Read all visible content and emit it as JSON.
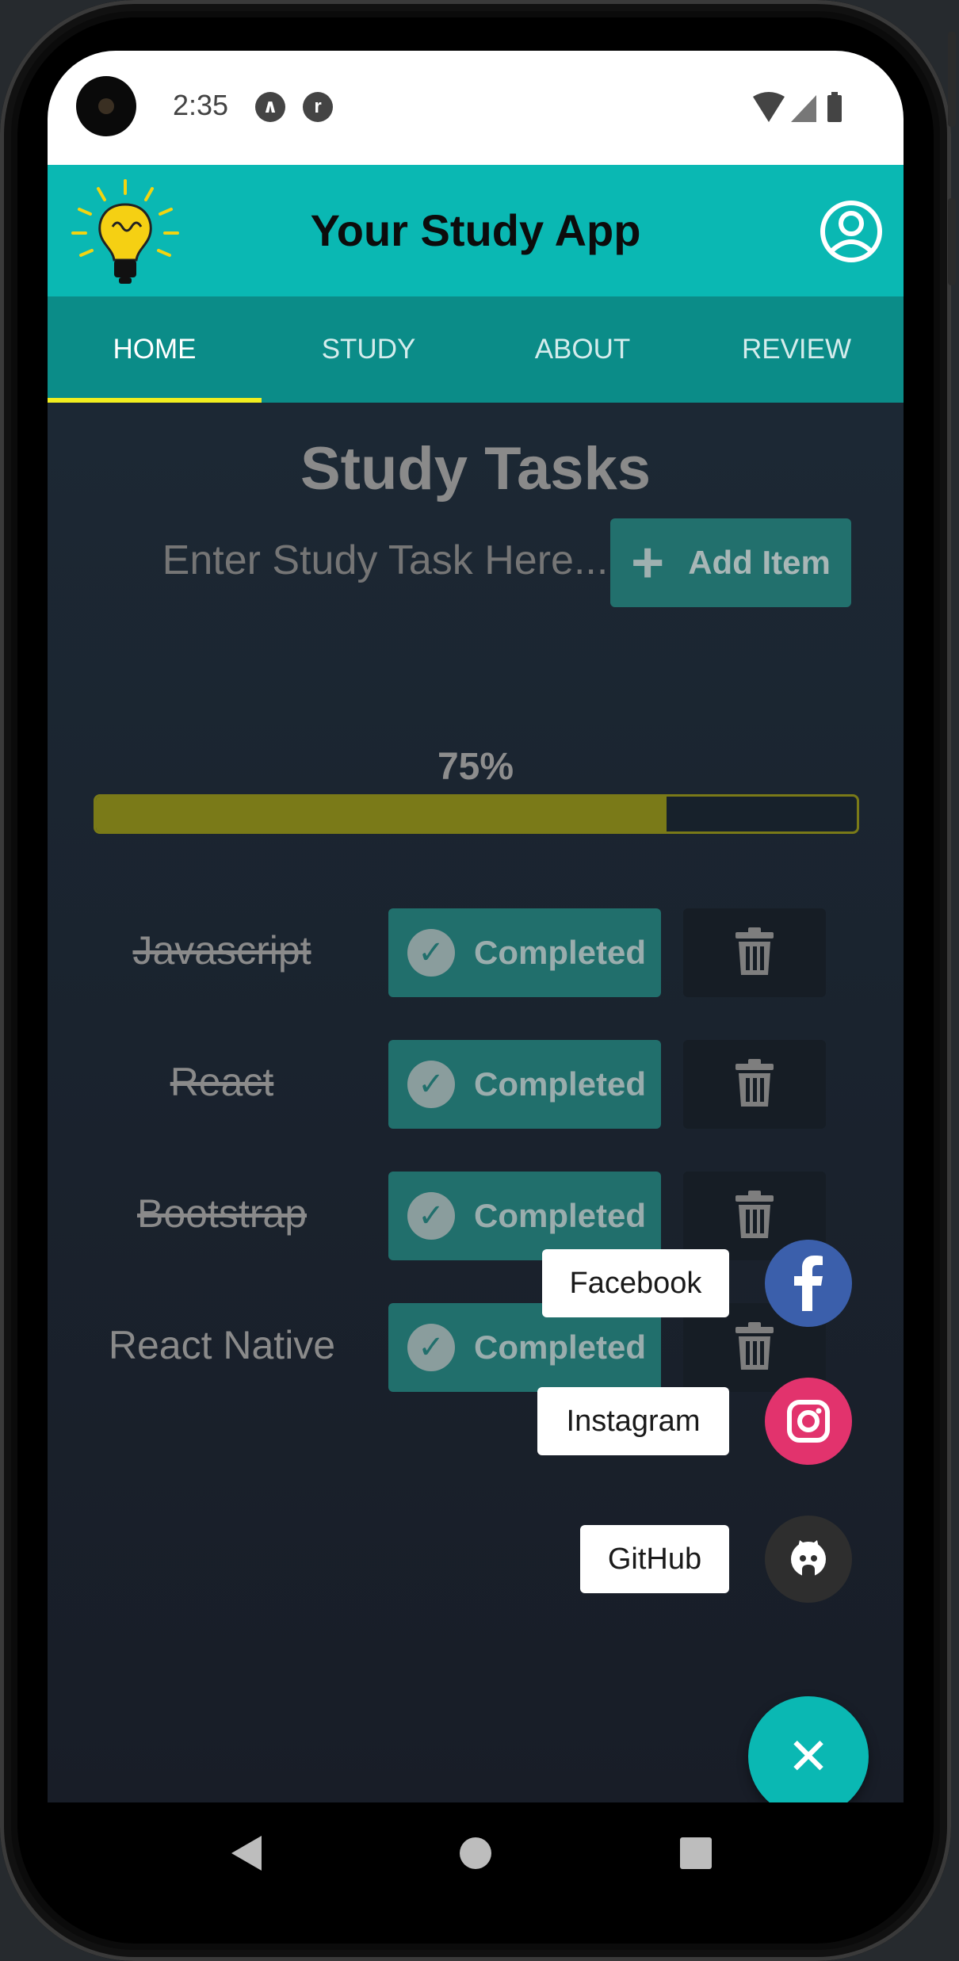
{
  "status": {
    "time": "2:35"
  },
  "header": {
    "title": "Your Study App"
  },
  "tabs": [
    {
      "label": "HOME",
      "active": true
    },
    {
      "label": "STUDY",
      "active": false
    },
    {
      "label": "ABOUT",
      "active": false
    },
    {
      "label": "REVIEW",
      "active": false
    }
  ],
  "main": {
    "title": "Study Tasks",
    "input_placeholder": "Enter Study Task Here...",
    "add_label": "Add Item",
    "progress_label": "75%",
    "progress_value": 0.75,
    "tasks": [
      {
        "name": "Javascript",
        "status": "Completed",
        "done": true
      },
      {
        "name": "React",
        "status": "Completed",
        "done": true
      },
      {
        "name": "Bootstrap",
        "status": "Completed",
        "done": true
      },
      {
        "name": "React Native",
        "status": "Completed",
        "done": false
      }
    ]
  },
  "fab": {
    "items": [
      {
        "label": "Facebook",
        "icon": "facebook-icon",
        "color": "#3b5fab"
      },
      {
        "label": "Instagram",
        "icon": "instagram-icon",
        "color": "#e2336d"
      },
      {
        "label": "GitHub",
        "icon": "github-icon",
        "color": "#2e2e2e"
      }
    ],
    "main_icon": "close-icon",
    "main_color": "#0ab8b3"
  },
  "colors": {
    "accent": "#0ab8b3",
    "tab_bar": "#0b8c88",
    "tab_indicator": "#f1ee1f",
    "progress": "#7a7a18",
    "background": "#1b222c"
  }
}
